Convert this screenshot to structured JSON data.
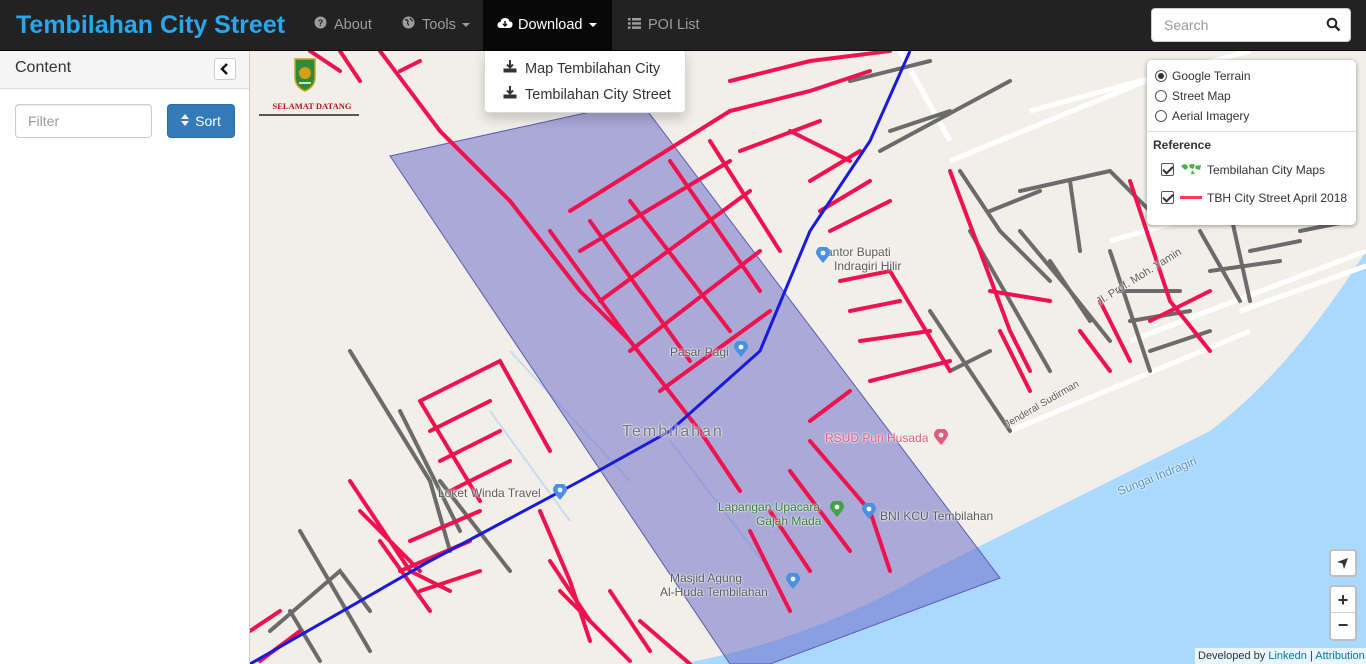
{
  "navbar": {
    "brand": "Tembilahan City Street",
    "items": [
      {
        "label": "About",
        "icon": "question-circle-icon"
      },
      {
        "label": "Tools",
        "icon": "globe-icon",
        "has_caret": true
      },
      {
        "label": "Download",
        "icon": "cloud-download-icon",
        "has_caret": true,
        "open": true
      },
      {
        "label": "POI List",
        "icon": "list-icon"
      }
    ],
    "search_placeholder": "Search"
  },
  "download_menu": {
    "items": [
      "Map Tembilahan City",
      "Tembilahan City Street"
    ]
  },
  "sidebar": {
    "title": "Content",
    "filter_placeholder": "Filter",
    "sort_label": "Sort"
  },
  "layers": {
    "base": [
      {
        "label": "Google Terrain",
        "selected": true
      },
      {
        "label": "Street Map",
        "selected": false
      },
      {
        "label": "Aerial Imagery",
        "selected": false
      }
    ],
    "reference_title": "Reference",
    "overlays": [
      {
        "label": "Tembilahan City Maps",
        "checked": true,
        "swatch": "#4caf50"
      },
      {
        "label": "TBH City Street April 2018",
        "checked": true,
        "swatch": "#ff3a4f"
      }
    ]
  },
  "map": {
    "logo_text": "SELAMAT DATANG",
    "place_labels": {
      "kantor": "Kantor Bupati",
      "kantor2": "Indragiri Hilir",
      "pasar": "Pasar Pagi",
      "town": "Tembilahan",
      "rsud": "RSUD Puri Husada",
      "loket": "Loket Winda Travel",
      "lapangan": "Lapangan Upacara",
      "lapangan2": "Gajah Mada",
      "bni": "BNI KCU Tembilahan",
      "masjid": "Masjid Agung",
      "masjid2": "Al-Huda Tembilahan",
      "sungai": "Sungai Indragiri",
      "jl_prof": "Jl. Prof. Moh. Yamin",
      "jl_soedirman": "Jenderal Sudirman"
    },
    "colors": {
      "street": "#f0124f",
      "road": "#6b6b6b",
      "highway": "#1a1adb",
      "polygon": "#6f6fc8",
      "river": "#a9d9ff"
    }
  },
  "controls": {
    "zoom_in": "+",
    "zoom_out": "−"
  },
  "attribution": {
    "prefix": "Developed by",
    "link1": "Linkedn",
    "sep": "|",
    "link2": "Attribution"
  }
}
